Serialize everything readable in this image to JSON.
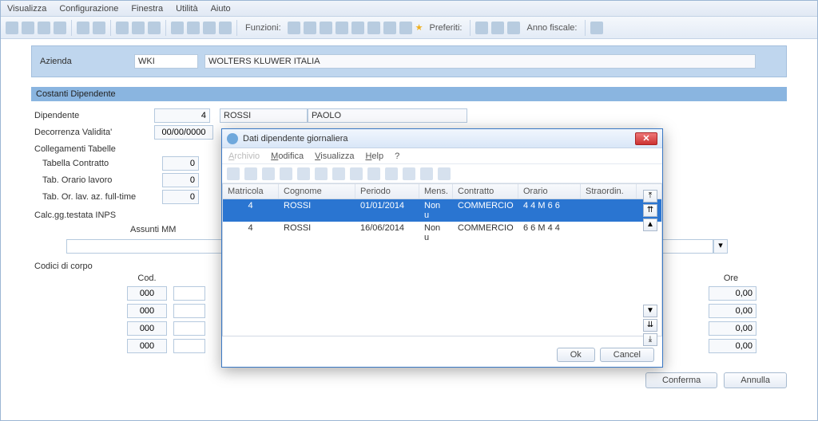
{
  "menu": {
    "items": [
      "Visualizza",
      "Configurazione",
      "Finestra",
      "Utilità",
      "Aiuto"
    ]
  },
  "toolbar": {
    "funzioni": "Funzioni:",
    "preferiti": "Preferiti:",
    "anno": "Anno fiscale:"
  },
  "azienda": {
    "label": "Azienda",
    "code": "WKI",
    "name": "WOLTERS KLUWER ITALIA"
  },
  "section1": "Costanti Dipendente",
  "dip": {
    "label": "Dipendente",
    "num": "4",
    "surname": "ROSSI",
    "name": "PAOLO"
  },
  "decorrenza": {
    "label": "Decorrenza Validita'",
    "value": "00/00/0000"
  },
  "coll": {
    "header": "Collegamenti Tabelle",
    "contratto": "Tabella Contratto",
    "orario": "Tab. Orario lavoro",
    "fulltime": "Tab. Or. lav. az. full-time",
    "zero": "0"
  },
  "calc": {
    "header": "Calc.gg.testata INPS",
    "assunti": "Assunti MM"
  },
  "codici": {
    "header": "Codici di corpo",
    "cod": "Cod.",
    "ore": "Ore",
    "code_val": "000",
    "ore_val": "0,00"
  },
  "buttons": {
    "conferma": "Conferma",
    "annulla": "Annulla"
  },
  "modal": {
    "title": "Dati dipendente giornaliera",
    "menu": [
      "Archivio",
      "Modifica",
      "Visualizza",
      "Help",
      "?"
    ],
    "columns": [
      "Matricola",
      "Cognome",
      "Periodo",
      "Mens.",
      "Contratto",
      "Orario",
      "Straordin."
    ],
    "rows": [
      {
        "mat": "4",
        "cog": "ROSSI",
        "per": "01/01/2014",
        "men": "Non u",
        "con": "COMMERCIO",
        "ora": "4 4 M 6 6",
        "str": ""
      },
      {
        "mat": "4",
        "cog": "ROSSI",
        "per": "16/06/2014",
        "men": "Non u",
        "con": "COMMERCIO",
        "ora": "6 6 M 4 4",
        "str": ""
      }
    ],
    "ok": "Ok",
    "cancel": "Cancel"
  },
  "chart_data": {
    "type": "table",
    "title": "Dati dipendente giornaliera",
    "columns": [
      "Matricola",
      "Cognome",
      "Periodo",
      "Mens.",
      "Contratto",
      "Orario",
      "Straordin."
    ],
    "rows": [
      [
        "4",
        "ROSSI",
        "01/01/2014",
        "Non u",
        "COMMERCIO",
        "4 4 M 6 6",
        ""
      ],
      [
        "4",
        "ROSSI",
        "16/06/2014",
        "Non u",
        "COMMERCIO",
        "6 6 M 4 4",
        ""
      ]
    ]
  }
}
